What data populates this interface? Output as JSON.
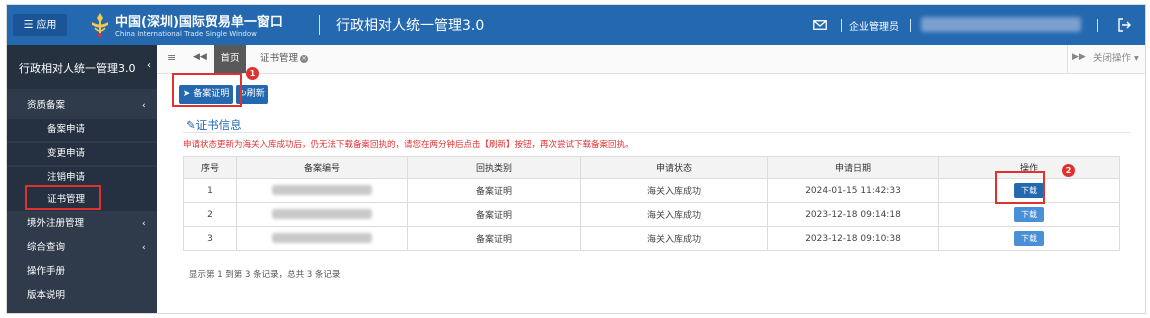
{
  "header": {
    "app_button": "应用",
    "logo_title": "中国(深圳)国际贸易单一窗口",
    "logo_subtitle": "China International Trade Single Window",
    "system_title": "行政相对人统一管理3.0",
    "user_role": "企业管理员",
    "icons": {
      "menu": "hamburger-icon",
      "mail": "mail-icon",
      "logout": "logout-icon"
    }
  },
  "sidebar": {
    "title": "行政相对人统一管理3.0",
    "groups": [
      {
        "label": "资质备案",
        "expanded": true,
        "items": [
          "备案申请",
          "变更申请",
          "注销申请",
          "证书管理"
        ]
      },
      {
        "label": "境外注册管理",
        "expanded": false
      },
      {
        "label": "综合查询",
        "expanded": false
      },
      {
        "label": "操作手册"
      },
      {
        "label": "版本说明"
      }
    ],
    "active_item": "证书管理"
  },
  "tabs": {
    "home": "首页",
    "current": "证书管理",
    "close_ops": "关闭操作"
  },
  "toolbar": {
    "record_proof": "备案证明",
    "refresh": "刷新"
  },
  "section": {
    "title": "证书信息",
    "warning": "申请状态更新为海关入库成功后，仍无法下载备案回执的，请您在两分钟后点击【刷新】按钮，再次尝试下载备案回执。"
  },
  "table": {
    "columns": [
      "序号",
      "备案编号",
      "回执类别",
      "申请状态",
      "申请日期",
      "操作"
    ],
    "rows": [
      {
        "no": "1",
        "receipt_type": "备案证明",
        "status": "海关入库成功",
        "date": "2024-01-15 11:42:33",
        "action": "下载"
      },
      {
        "no": "2",
        "receipt_type": "备案证明",
        "status": "海关入库成功",
        "date": "2023-12-18 09:14:18",
        "action": "下载"
      },
      {
        "no": "3",
        "receipt_type": "备案证明",
        "status": "海关入库成功",
        "date": "2023-12-18 09:10:38",
        "action": "下载"
      }
    ],
    "footer": "显示第 1 到第 3 条记录，总共 3 条记录"
  },
  "annotations": {
    "step1": "1",
    "step2": "2"
  },
  "colors": {
    "primary": "#2468b0",
    "sidebar": "#2f3b4a",
    "highlight": "#e03131"
  }
}
